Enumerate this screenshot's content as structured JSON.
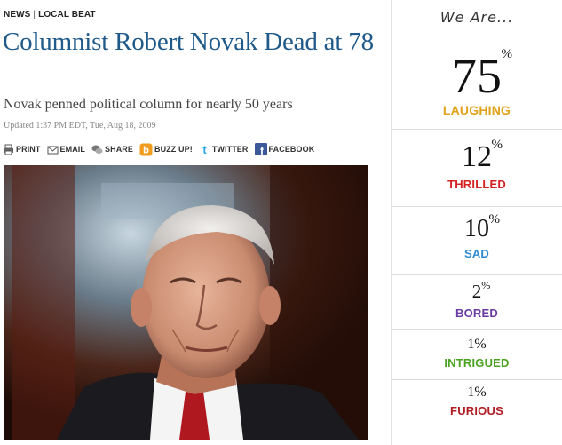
{
  "nav": {
    "section": "NEWS",
    "separator": "|",
    "subsection": "LOCAL BEAT"
  },
  "article": {
    "headline": "Columnist Robert Novak Dead at 78",
    "subhead": "Novak penned political column for nearly 50 years",
    "timestamp": "Updated 1:37 PM EDT, Tue, Aug 18, 2009"
  },
  "share": {
    "print": "PRINT",
    "email": "EMAIL",
    "share": "SHARE",
    "buzz": "BUZZ UP!",
    "twitter": "TWITTER",
    "facebook": "FACEBOOK"
  },
  "icons": [
    "print-icon",
    "email-icon",
    "share-icon",
    "buzz-up-icon",
    "twitter-icon",
    "facebook-icon"
  ],
  "sidebar": {
    "title": "We Are...",
    "moods": [
      {
        "value": "75",
        "sign": "%",
        "label": "LAUGHING",
        "color": "#e0a21a"
      },
      {
        "value": "12",
        "sign": "%",
        "label": "THRILLED",
        "color": "#d42121"
      },
      {
        "value": "10",
        "sign": "%",
        "label": "SAD",
        "color": "#2f8ad0"
      },
      {
        "value": "2",
        "sign": "%",
        "label": "BORED",
        "color": "#6a3aa3"
      },
      {
        "value": "1%",
        "sign": "",
        "label": "INTRIGUED",
        "color": "#4aa322"
      },
      {
        "value": "1%",
        "sign": "",
        "label": "FURIOUS",
        "color": "#b01c22"
      }
    ]
  },
  "colors": {
    "headline": "#1f5a8a",
    "facebook": "#3b5998",
    "twitter": "#2aa9e0",
    "buzz": "#f29c1f"
  }
}
